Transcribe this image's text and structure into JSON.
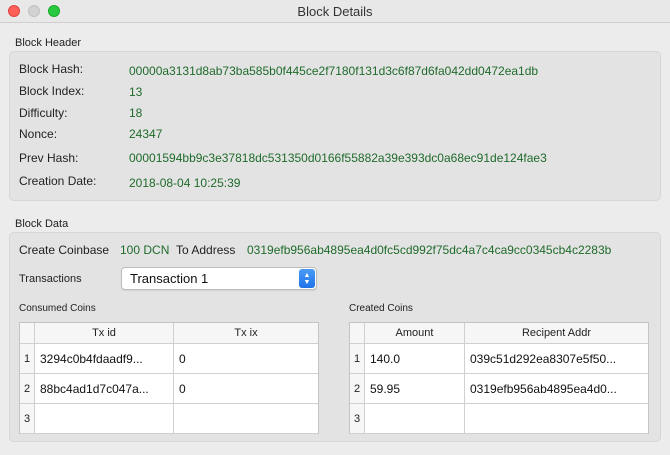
{
  "window": {
    "title": "Block Details"
  },
  "block_header": {
    "title": "Block Header",
    "fields": [
      {
        "label": "Block Hash:",
        "value": "00000a3131d8ab73ba585b0f445ce2f7180f131d3c6f87d6fa042dd0472ea1db"
      },
      {
        "label": "Block Index:",
        "value": "13"
      },
      {
        "label": "Difficulty:",
        "value": "18"
      },
      {
        "label": "Nonce:",
        "value": "24347"
      },
      {
        "label": "Prev Hash:",
        "value": "00001594bb9c3e37818dc531350d0166f55882a39e393dc0a68ec91de124fae3"
      },
      {
        "label": "Creation Date:",
        "value": "2018-08-04 10:25:39"
      }
    ]
  },
  "block_data": {
    "title": "Block Data",
    "coinbase_label": "Create Coinbase",
    "coinbase_amount": "100 DCN",
    "to_address_label": "To Address",
    "to_address": "0319efb956ab4895ea4d0fc5cd992f75dc4a7c4ca9cc0345cb4c2283b",
    "transactions_label": "Transactions",
    "transactions_selected": "Transaction 1",
    "consumed": {
      "title": "Consumed Coins",
      "columns": [
        "Tx id",
        "Tx ix"
      ],
      "rows": [
        {
          "num": "1",
          "c1": "3294c0b4fdaadf9...",
          "c2": "0"
        },
        {
          "num": "2",
          "c1": "88bc4ad1d7c047a...",
          "c2": "0"
        },
        {
          "num": "3",
          "c1": "",
          "c2": ""
        }
      ]
    },
    "created": {
      "title": "Created Coins",
      "columns": [
        "Amount",
        "Recipent Addr"
      ],
      "rows": [
        {
          "num": "1",
          "c1": "140.0",
          "c2": "039c51d292ea8307e5f50..."
        },
        {
          "num": "2",
          "c1": "59.95",
          "c2": "0319efb956ab4895ea4d0..."
        },
        {
          "num": "3",
          "c1": "",
          "c2": ""
        }
      ]
    }
  },
  "colors": {
    "value_green": "#1f6b2b",
    "close": "#fe5f57",
    "maximize": "#28c840",
    "select_accent": "#1f73e8"
  }
}
